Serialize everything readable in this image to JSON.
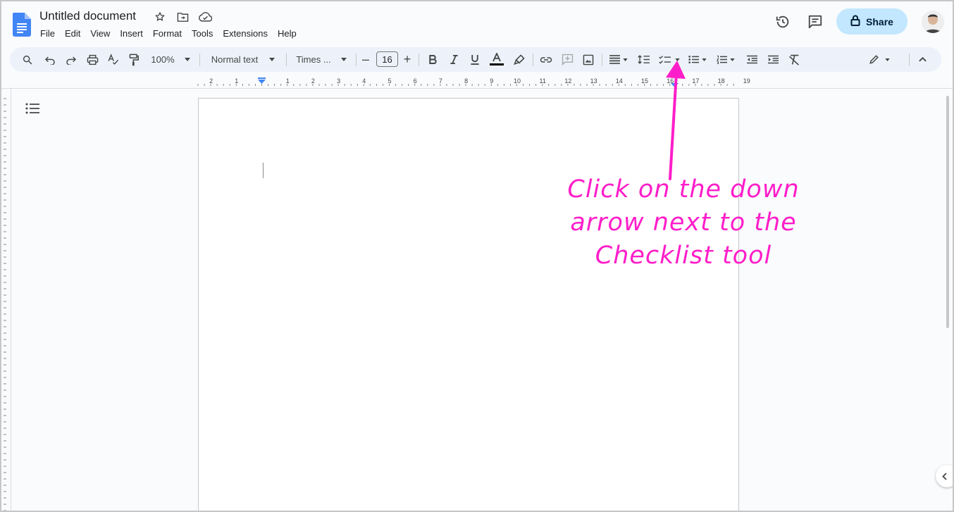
{
  "document": {
    "title": "Untitled document"
  },
  "menu": [
    "File",
    "Edit",
    "View",
    "Insert",
    "Format",
    "Tools",
    "Extensions",
    "Help"
  ],
  "header": {
    "share_label": "Share"
  },
  "toolbar": {
    "zoom": "100%",
    "style": "Normal text",
    "font": "Times ...",
    "font_size": "16"
  },
  "ruler": {
    "labels": [
      "2",
      "1",
      "1",
      "2",
      "3",
      "4",
      "5",
      "6",
      "7",
      "8",
      "9",
      "10",
      "11",
      "12",
      "13",
      "14",
      "15",
      "16",
      "17",
      "18",
      "19"
    ]
  },
  "annotation": {
    "line1": "Click on the down",
    "line2": "arrow next to the",
    "line3": "Checklist tool"
  },
  "colors": {
    "accent": "#ff1ec9",
    "share_bg": "#c2e7ff",
    "toolbar_bg": "#edf2fa",
    "docs_blue": "#4285f4"
  },
  "icons": [
    "docs-logo-icon",
    "star-icon",
    "move-folder-icon",
    "cloud-status-icon",
    "history-icon",
    "comments-icon",
    "lock-icon",
    "search-icon",
    "undo-icon",
    "redo-icon",
    "print-icon",
    "spellcheck-icon",
    "paint-format-icon",
    "bold-icon",
    "italic-icon",
    "underline-icon",
    "text-color-icon",
    "highlight-icon",
    "link-icon",
    "add-comment-icon",
    "insert-image-icon",
    "align-icon",
    "line-spacing-icon",
    "checklist-icon",
    "bulleted-list-icon",
    "numbered-list-icon",
    "decrease-indent-icon",
    "increase-indent-icon",
    "clear-formatting-icon",
    "editing-mode-icon",
    "collapse-icon",
    "outline-icon"
  ]
}
